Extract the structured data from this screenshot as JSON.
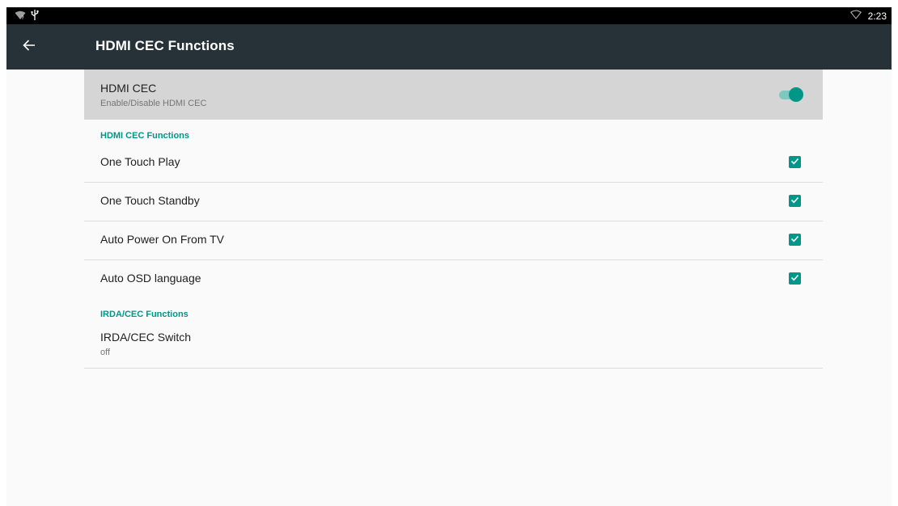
{
  "status_bar": {
    "time": "2:23",
    "left_icons": [
      "wifi-unknown-icon",
      "usb-icon"
    ],
    "right_icons": [
      "wifi-empty-icon"
    ]
  },
  "app_bar": {
    "title": "HDMI CEC Functions",
    "back_icon": "arrow-back-icon"
  },
  "hdmi_cec": {
    "title": "HDMI CEC",
    "summary": "Enable/Disable HDMI CEC",
    "enabled": true
  },
  "categories": {
    "hdmi_cec_functions": "HDMI CEC Functions",
    "irda_cec_functions": "IRDA/CEC Functions"
  },
  "checkbox_items": [
    {
      "label": "One Touch Play",
      "checked": true
    },
    {
      "label": "One Touch Standby",
      "checked": true
    },
    {
      "label": "Auto Power On From TV",
      "checked": true
    },
    {
      "label": "Auto OSD language",
      "checked": true
    }
  ],
  "irda_switch": {
    "title": "IRDA/CEC Switch",
    "value": "off"
  },
  "colors": {
    "accent": "#009688",
    "app_bar": "#263238",
    "status_bar": "#000000",
    "highlight_row": "#d5d5d5"
  }
}
